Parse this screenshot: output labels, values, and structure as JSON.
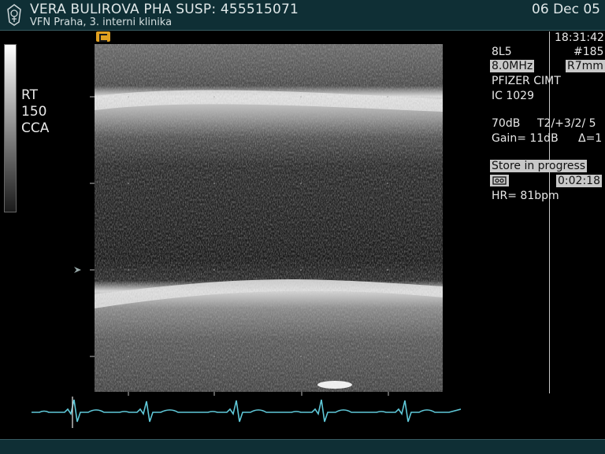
{
  "header": {
    "patient": "VERA BULIROVA PHA SUSP: 455515071",
    "hospital": "VFN  Praha, 3. interni klinika",
    "date": "06 Dec 05",
    "logo_icon": "hospital-emblem-icon"
  },
  "left_info": {
    "side": "RT",
    "number": "150",
    "vessel": "CCA"
  },
  "right_panel": {
    "time": "18:31:42",
    "probe": "8L5",
    "frame": "#185",
    "frequency": "8.0MHz",
    "depth": "R7mm",
    "study": "PFIZER CIMT",
    "ic": "IC 1029",
    "dynamic_range": "70dB",
    "transmit": "T2/+3/2/ 5",
    "gain": "Gain=  11dB",
    "delta": "Δ=1",
    "store_status": "Store in progress",
    "tape_icon": "tape-icon",
    "store_time": "0:02:18",
    "heart_rate": "HR=  81bpm"
  },
  "colors": {
    "header_bg": "#0f2f35",
    "ecg_trace": "#5fc8d8",
    "probe_icon": "#e0a020",
    "highlight_box": "#c8c8c8"
  }
}
